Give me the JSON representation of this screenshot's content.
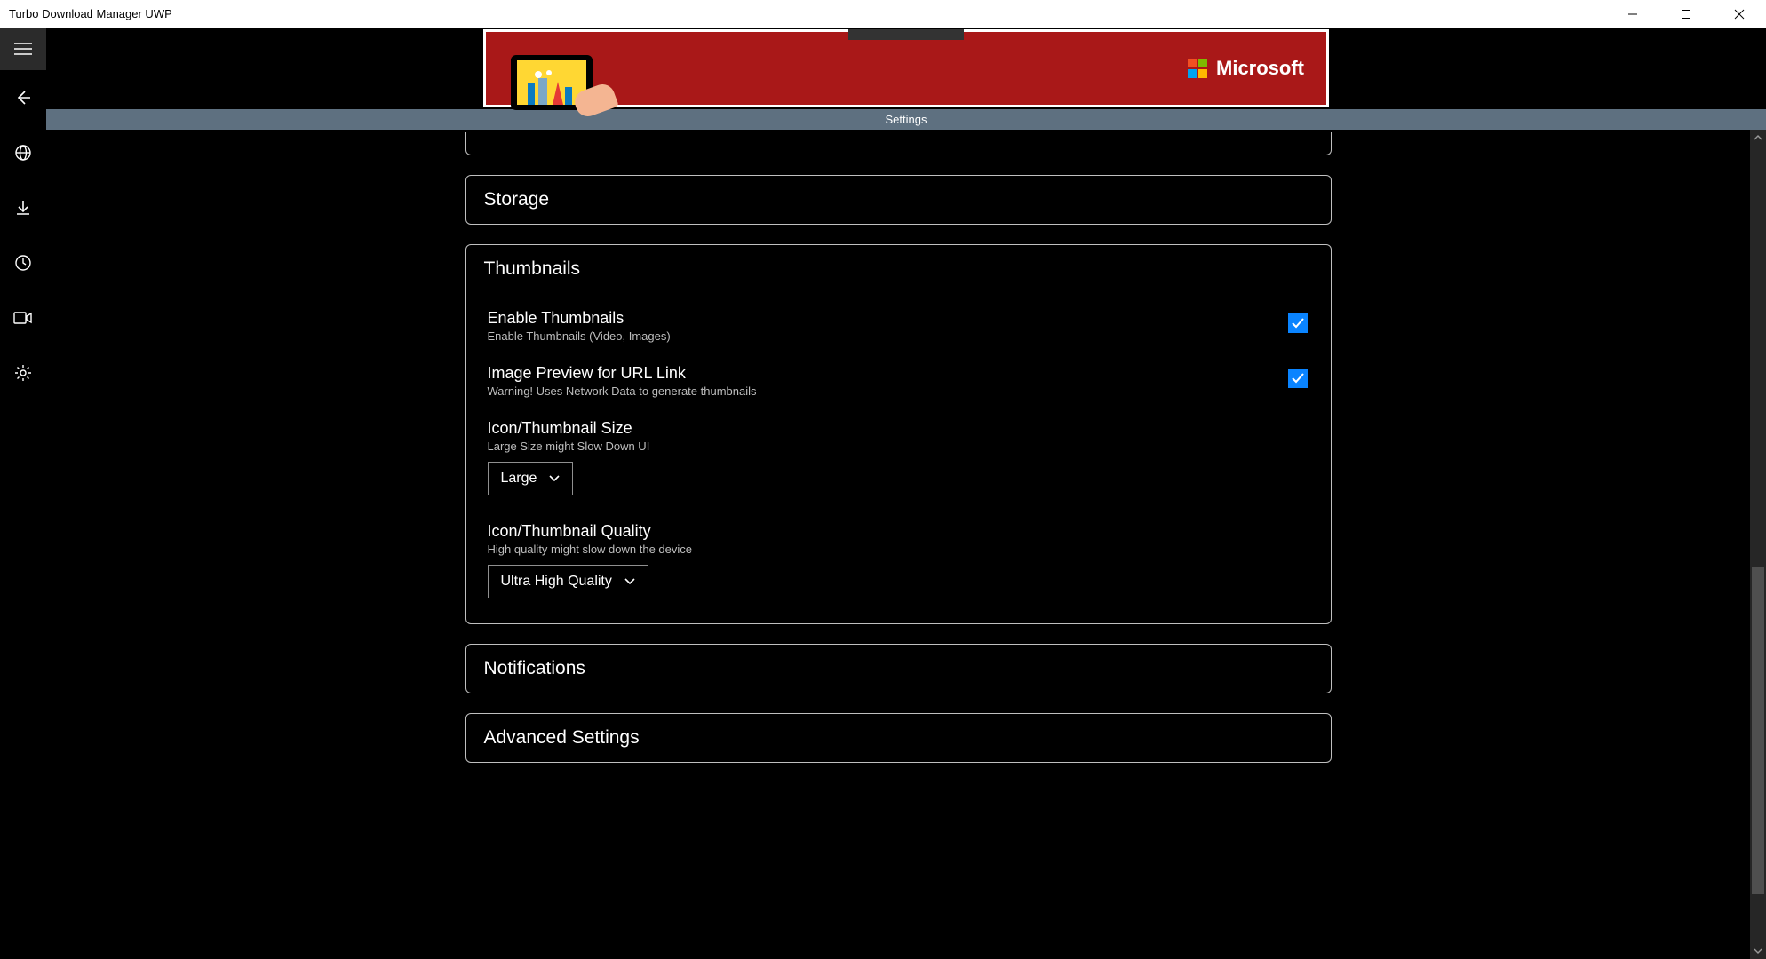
{
  "window": {
    "title": "Turbo Download Manager UWP"
  },
  "ad": {
    "brand": "Microsoft"
  },
  "strip": {
    "label": "Settings"
  },
  "sections": {
    "storage": {
      "title": "Storage"
    },
    "thumbnails": {
      "title": "Thumbnails",
      "enable": {
        "title": "Enable Thumbnails",
        "sub": "Enable Thumbnails (Video, Images)",
        "checked": true
      },
      "imagePreview": {
        "title": "Image Preview for URL Link",
        "sub": "Warning! Uses Network Data to generate thumbnails",
        "checked": true
      },
      "size": {
        "title": "Icon/Thumbnail Size",
        "sub": "Large Size might Slow Down UI",
        "value": "Large"
      },
      "quality": {
        "title": "Icon/Thumbnail Quality",
        "sub": "High quality might slow down the device",
        "value": "Ultra High Quality"
      }
    },
    "notifications": {
      "title": "Notifications"
    },
    "advanced": {
      "title": "Advanced Settings"
    }
  }
}
